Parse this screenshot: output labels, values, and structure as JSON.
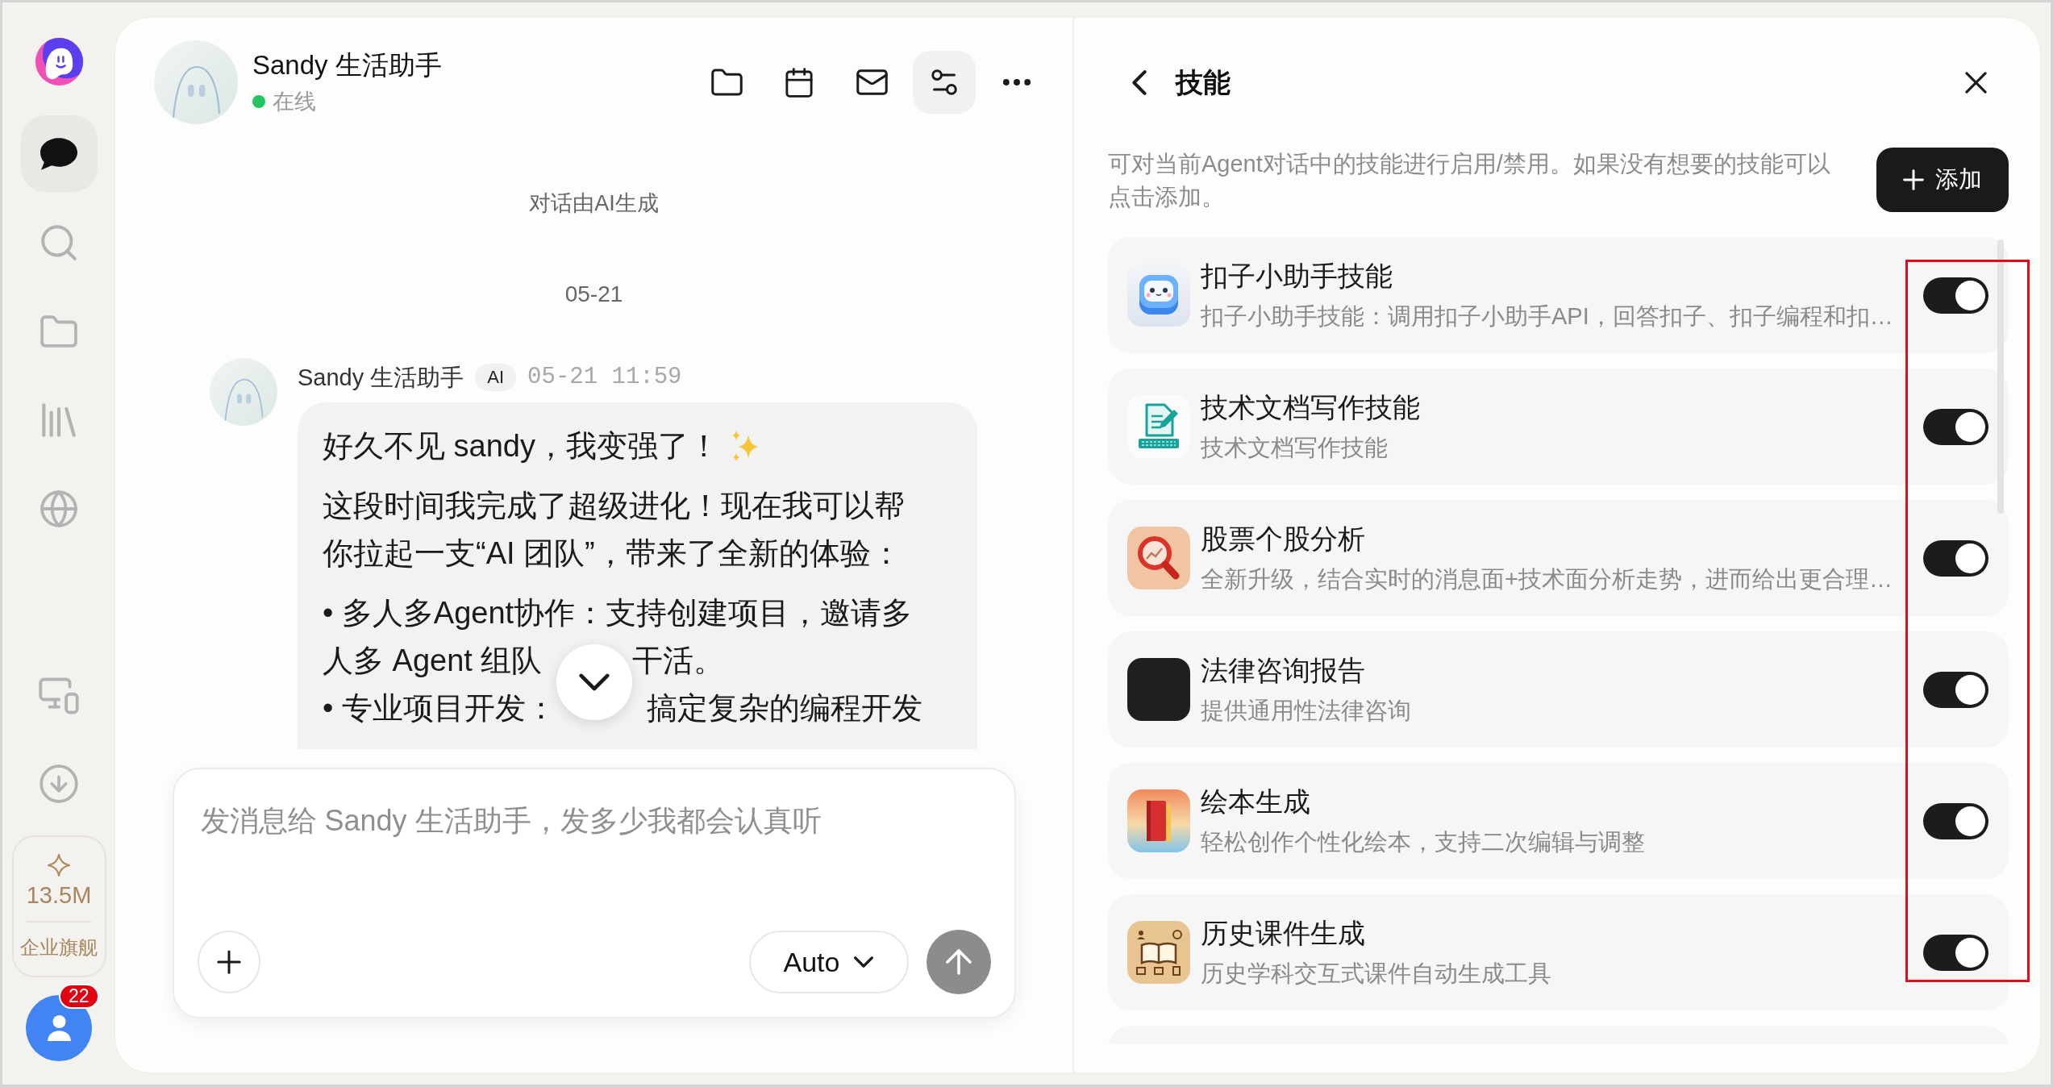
{
  "sidebar": {
    "nav": [
      {
        "kind": "chat",
        "selected": true
      },
      {
        "kind": "search",
        "selected": false
      },
      {
        "kind": "folder",
        "selected": false
      },
      {
        "kind": "library",
        "selected": false
      },
      {
        "kind": "globe",
        "selected": false
      }
    ],
    "tools": [
      {
        "kind": "devices"
      },
      {
        "kind": "download"
      }
    ],
    "credits": {
      "amount": "13.5M",
      "plan": "企业旗舰"
    },
    "notifications": "22"
  },
  "chat": {
    "agent": {
      "name": "Sandy 生活助手",
      "status": "在线",
      "online": true
    },
    "actions": [
      {
        "kind": "folder",
        "selected": false
      },
      {
        "kind": "calendar",
        "selected": false
      },
      {
        "kind": "mail",
        "selected": false
      },
      {
        "kind": "skills",
        "selected": true
      },
      {
        "kind": "more",
        "selected": false
      }
    ],
    "notice": "对话由AI生成",
    "date": "05-21",
    "message": {
      "sender": "Sandy 生活助手",
      "badge": "AI",
      "time": "05-21 11:59",
      "paragraphs": [
        {
          "kind": "greeting",
          "parts": [
            "好久不见 sandy，我变强了！"
          ]
        },
        {
          "kind": "paragraph",
          "parts": [
            "这段时间我完成了超级进化！现在我可以帮你拉起一支“AI 团队”，带来了全新的体验："
          ]
        },
        {
          "kind": "bullet",
          "parts": [
            "• 多人多Agent协作：支持创建项目，邀请多人多 Agent 组队",
            "干活。"
          ]
        },
        {
          "kind": "bullet",
          "parts": [
            "• 专业项目开发：",
            "搞定复杂的编程开发"
          ]
        }
      ]
    },
    "composer": {
      "placeholder": "发消息给 Sandy 生活助手，发多少我都会认真听",
      "model": "Auto",
      "send_disabled": true
    }
  },
  "skills_panel": {
    "title": "技能",
    "description": "可对当前Agent对话中的技能进行启用/禁用。如果没有想要的技能可以点击添加。",
    "add_button": "添加",
    "skills": [
      {
        "kind": "robot",
        "name": "扣子小助手技能",
        "description": "扣子小助手技能：调用扣子小助手API，回答扣子、扣子编程和扣…",
        "on": true
      },
      {
        "kind": "document",
        "name": "技术文档写作技能",
        "description": "技术文档写作技能",
        "on": true
      },
      {
        "kind": "magnifier",
        "name": "股票个股分析",
        "description": "全新升级，结合实时的消息面+技术面分析走势，进而给出更合理…",
        "on": true
      },
      {
        "kind": "photo",
        "name": "法律咨询报告",
        "description": "提供通用性法律咨询",
        "on": true
      },
      {
        "kind": "book",
        "name": "绘本生成",
        "description": "轻松创作个性化绘本，支持二次编辑与调整",
        "on": true
      },
      {
        "kind": "open_book",
        "name": "历史课件生成",
        "description": "历史学科交互式课件自动生成工具",
        "on": true
      }
    ]
  }
}
